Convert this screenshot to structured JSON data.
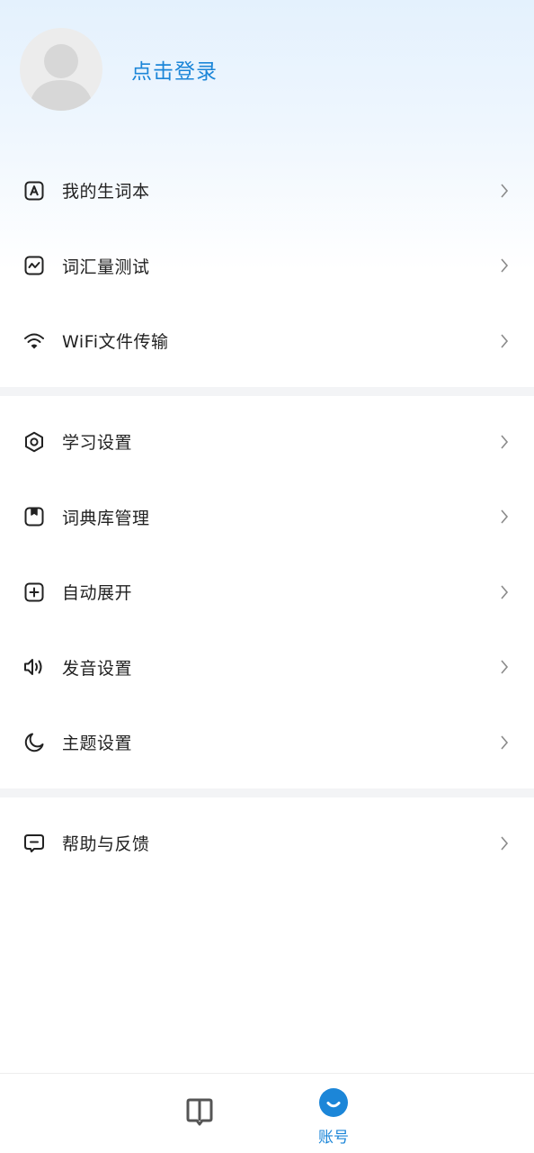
{
  "profile": {
    "login_label": "点击登录"
  },
  "menu_group_1": [
    {
      "label": "我的生词本",
      "icon": "letter-a-box-icon"
    },
    {
      "label": "词汇量测试",
      "icon": "line-chart-box-icon"
    },
    {
      "label": "WiFi文件传输",
      "icon": "wifi-icon"
    }
  ],
  "menu_group_2": [
    {
      "label": "学习设置",
      "icon": "hexagon-settings-icon"
    },
    {
      "label": "词典库管理",
      "icon": "bookmark-box-icon"
    },
    {
      "label": "自动展开",
      "icon": "plus-box-icon"
    },
    {
      "label": "发音设置",
      "icon": "speaker-icon"
    },
    {
      "label": "主题设置",
      "icon": "moon-icon"
    }
  ],
  "menu_group_3": [
    {
      "label": "帮助与反馈",
      "icon": "message-box-icon"
    }
  ],
  "tabbar": {
    "tabs": [
      {
        "label": "",
        "icon": "book-icon",
        "active": false
      },
      {
        "label": "账号",
        "icon": "smile-face-icon",
        "active": true
      }
    ]
  },
  "colors": {
    "accent": "#1c86d8",
    "header_gradient_top": "#e4f1fd",
    "divider": "#f3f4f6"
  }
}
